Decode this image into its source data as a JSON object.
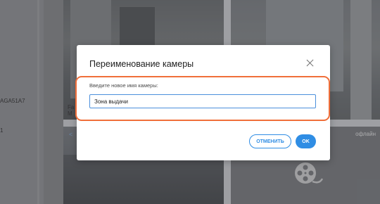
{
  "sidebar": {
    "devices": [
      {
        "label": "AGA51A7"
      },
      {
        "label": "1"
      }
    ]
  },
  "cameras": [
    {
      "label": "Fa",
      "sublabel": "M"
    },
    {
      "label": ""
    },
    {
      "label": ""
    },
    {
      "status": "офлайн"
    }
  ],
  "rename_dialog": {
    "title": "Переименование камеры",
    "field_label": "Введите новое имя камеры:",
    "field_value": "Зона выдачи",
    "cancel_label": "ОТМЕНИТЬ",
    "ok_label": "OK"
  },
  "colors": {
    "accent": "#2f8de4",
    "focus_ring": "#f06f3a"
  }
}
